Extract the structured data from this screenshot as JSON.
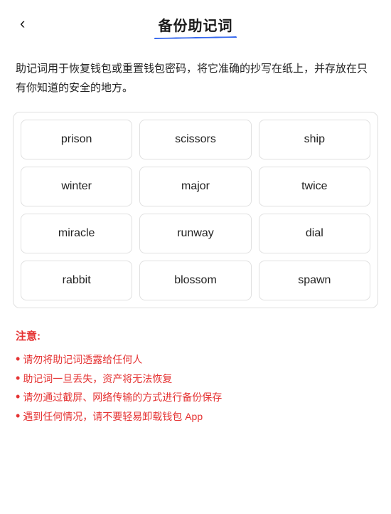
{
  "header": {
    "back_label": "‹",
    "title": "备份助记词"
  },
  "description": "助记词用于恢复钱包或重置钱包密码，将它准确的抄写在纸上，并存放在只有你知道的安全的地方。",
  "mnemonic_grid": {
    "words": [
      "prison",
      "scissors",
      "ship",
      "winter",
      "major",
      "twice",
      "miracle",
      "runway",
      "dial",
      "rabbit",
      "blossom",
      "spawn"
    ]
  },
  "notice": {
    "title": "注意:",
    "items": [
      "请勿将助记词透露给任何人",
      "助记词一旦丢失，资产将无法恢复",
      "请勿通过截屏、网络传输的方式进行备份保存",
      "遇到任何情况，请不要轻易卸载钱包 App"
    ]
  }
}
